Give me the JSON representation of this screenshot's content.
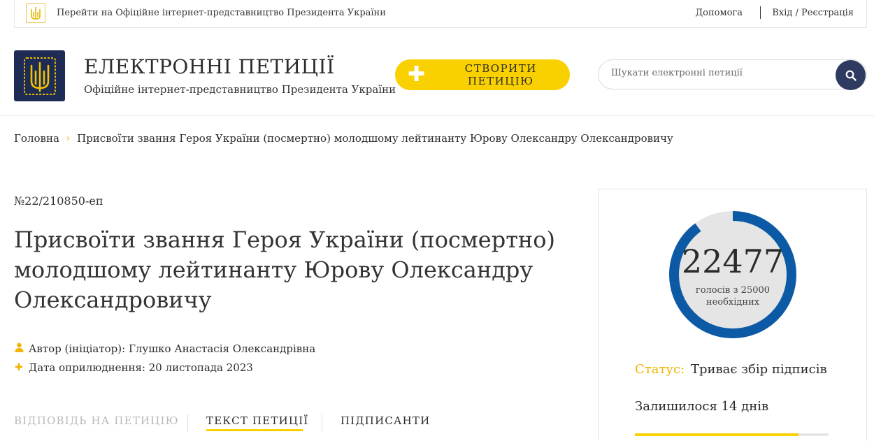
{
  "topbar": {
    "president_link": "Перейти на Офіційне інтернет-представництво Президента України",
    "help": "Допомога",
    "login": "Вхід / Реєстрація"
  },
  "header": {
    "title": "ЕЛЕКТРОННІ ПЕТИЦІЇ",
    "subtitle": "Офіційне інтернет-представництво Президента України",
    "create_button": "СТВОРИТИ ПЕТИЦІЮ",
    "search_placeholder": "Шукати електронні петиції"
  },
  "breadcrumb": {
    "home": "Головна",
    "current": "Присвоїти звання Героя України (посмертно) молодшому лейтинанту Юрову Олександру Олександровичу"
  },
  "petition": {
    "number": "№22/210850-еп",
    "title": "Присвоїти звання Героя України (посмертно) молодшому лейтинанту Юрову Олександру Олександровичу",
    "author": "Автор (ініціатор): Глушко Анастасія Олександрівна",
    "date": "Дата оприлюднення: 20 листопада 2023"
  },
  "tabs": [
    {
      "label": "ВІДПОВІДЬ НА ПЕТИЦІЮ",
      "state": "disabled"
    },
    {
      "label": "ТЕКСТ ПЕТИЦІЇ",
      "state": "active"
    },
    {
      "label": "ПІДПИСАНТИ",
      "state": "normal"
    }
  ],
  "votes": {
    "count": "22477",
    "count_value": 22477,
    "target_value": 25000,
    "caption": "голосів з 25000 необхідних",
    "status_label": "Статус:",
    "status_value": "Триває збір підписів",
    "remaining": "Залишилося 14 днів"
  },
  "colors": {
    "accent_yellow": "#f9d000",
    "gauge_blue": "#0c5aa6",
    "navy": "#1d2b55"
  },
  "icons": {
    "mini_emblem": "trident-icon",
    "emblem": "trident-icon",
    "search": "search-icon",
    "author": "user-icon",
    "date": "plus-icon"
  }
}
